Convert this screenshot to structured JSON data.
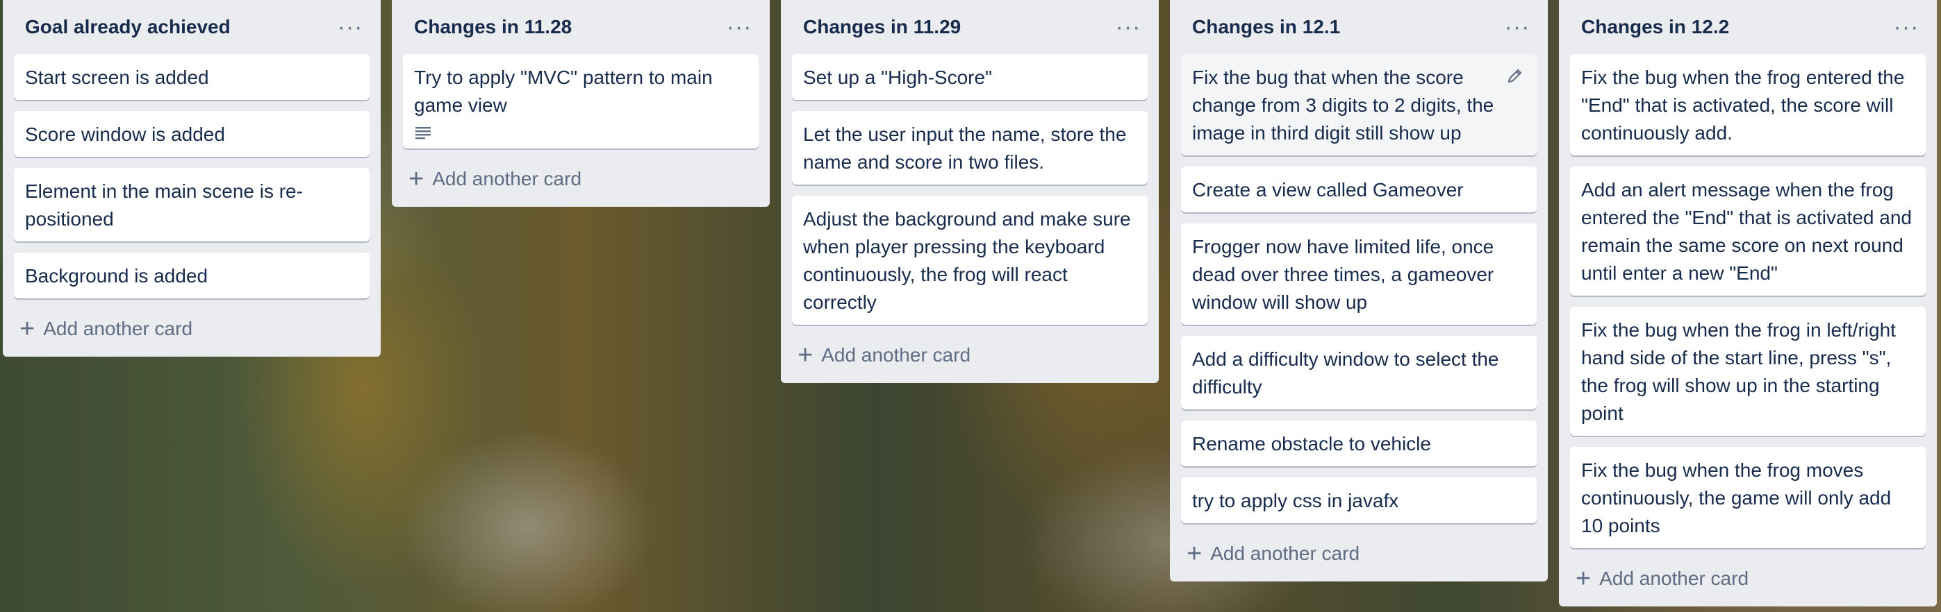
{
  "board": {
    "lists": [
      {
        "title": "Goal already achieved",
        "cards": [
          {
            "text": "Start screen is added"
          },
          {
            "text": "Score window is added"
          },
          {
            "text": "Element in the main scene is re-positioned"
          },
          {
            "text": "Background is added"
          }
        ],
        "add_label": "Add another card"
      },
      {
        "title": "Changes in 11.28",
        "cards": [
          {
            "text": "Try to apply \"MVC\" pattern to main game view",
            "has_description": true
          }
        ],
        "add_label": "Add another card"
      },
      {
        "title": "Changes in 11.29",
        "cards": [
          {
            "text": "Set up a \"High-Score\""
          },
          {
            "text": "Let the user input the name, store the name and score in two files."
          },
          {
            "text": "Adjust the background and make sure when player pressing the keyboard continuously, the frog will react correctly"
          }
        ],
        "add_label": "Add another card"
      },
      {
        "title": "Changes in 12.1",
        "cards": [
          {
            "text": "Fix the bug that when the score change from 3 digits to 2 digits, the image in third digit still show up",
            "hovered": true
          },
          {
            "text": "Create a view called Gameover"
          },
          {
            "text": "Frogger now have limited life, once dead over three times, a gameover window will show up"
          },
          {
            "text": "Add a difficulty window to select the difficulty"
          },
          {
            "text": "Rename obstacle to vehicle"
          },
          {
            "text": "try to apply css in javafx"
          }
        ],
        "add_label": "Add another card"
      },
      {
        "title": "Changes in 12.2",
        "cards": [
          {
            "text": "Fix the bug when the frog entered the \"End\" that is activated, the score will continuously add."
          },
          {
            "text": "Add an alert message when the frog entered the \"End\" that is activated and remain the same score on next round until enter a new \"End\""
          },
          {
            "text": "Fix the bug when the frog in left/right hand side of the start line, press \"s\", the frog will show up in the starting point"
          },
          {
            "text": "Fix the bug when the frog moves continuously, the game will only add 10 points"
          }
        ],
        "add_label": "Add another card"
      }
    ]
  },
  "icons": {
    "list_menu": "more-horizontal-icon",
    "add": "plus-icon",
    "description": "description-lines-icon",
    "edit": "pencil-icon"
  },
  "colors": {
    "list_bg": "#ebecf0",
    "card_bg": "#ffffff",
    "title_text": "#172b4d",
    "muted_text": "#5e6c84"
  }
}
